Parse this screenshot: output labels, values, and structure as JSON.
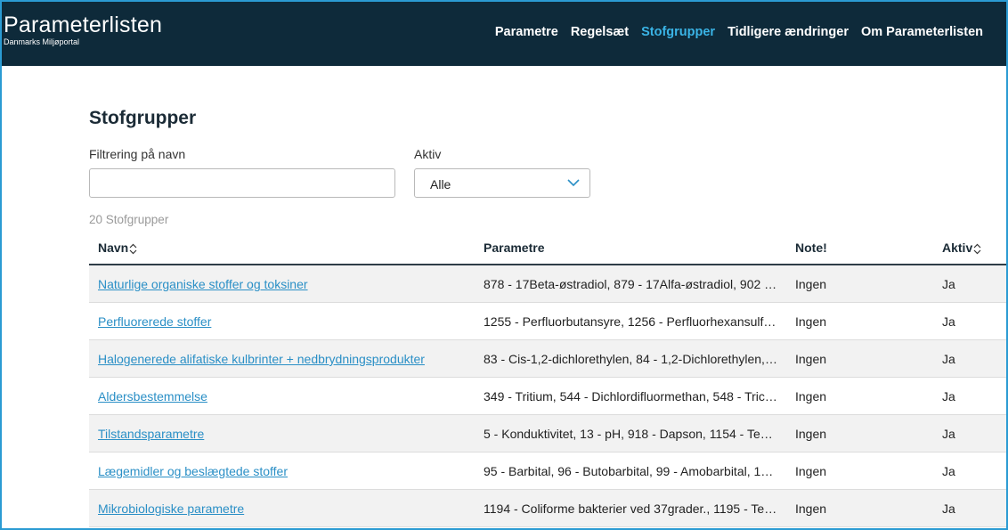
{
  "header": {
    "logo_title": "Parameterlisten",
    "logo_subtitle": "Danmarks Miljøportal",
    "nav": [
      {
        "label": "Parametre",
        "active": false
      },
      {
        "label": "Regelsæt",
        "active": false
      },
      {
        "label": "Stofgrupper",
        "active": true
      },
      {
        "label": "Tidligere ændringer",
        "active": false
      },
      {
        "label": "Om Parameterlisten",
        "active": false
      }
    ]
  },
  "page": {
    "title": "Stofgrupper",
    "filter_name_label": "Filtrering på navn",
    "filter_name_value": "",
    "filter_active_label": "Aktiv",
    "filter_active_value": "Alle",
    "count_text": "20 Stofgrupper"
  },
  "table": {
    "headers": {
      "name": "Navn",
      "params": "Parametre",
      "note": "Note!",
      "active": "Aktiv"
    },
    "rows": [
      {
        "name": "Naturlige organiske stoffer og toksiner",
        "params": "878 - 17Beta-østradiol, 879 - 17Alfa-østradiol, 902 - …",
        "note": "Ingen",
        "active": "Ja"
      },
      {
        "name": "Perfluorerede stoffer",
        "params": "1255 - Perfluorbutansyre, 1256 - Perfluorhexansulfo…",
        "note": "Ingen",
        "active": "Ja"
      },
      {
        "name": "Halogenerede alifatiske kulbrinter + nedbrydningsprodukter",
        "params": "83 - Cis-1,2-dichlorethylen, 84 - 1,2-Dichlorethylen, 8…",
        "note": "Ingen",
        "active": "Ja"
      },
      {
        "name": "Aldersbestemmelse",
        "params": "349 - Tritium, 544 - Dichlordifluormethan, 548 - Trich…",
        "note": "Ingen",
        "active": "Ja"
      },
      {
        "name": "Tilstandsparametre",
        "params": "5 - Konduktivitet, 13 - pH, 918 - Dapson, 1154 - Temp…",
        "note": "Ingen",
        "active": "Ja"
      },
      {
        "name": "Lægemidler og beslægtede stoffer",
        "params": "95 - Barbital, 96 - Butobarbital, 99 - Amobarbital, 104…",
        "note": "Ingen",
        "active": "Ja"
      },
      {
        "name": "Mikrobiologiske parametre",
        "params": "1194 - Coliforme bakterier ved 37grader., 1195 - Ter…",
        "note": "Ingen",
        "active": "Ja"
      }
    ]
  },
  "colors": {
    "header_bg": "#0e2a3a",
    "accent": "#3ab4e6",
    "link": "#2a8fc6",
    "frame_border": "#2b9bd3"
  },
  "icons": {
    "sort": "sort-icon",
    "dropdown": "chevron-down-icon"
  }
}
